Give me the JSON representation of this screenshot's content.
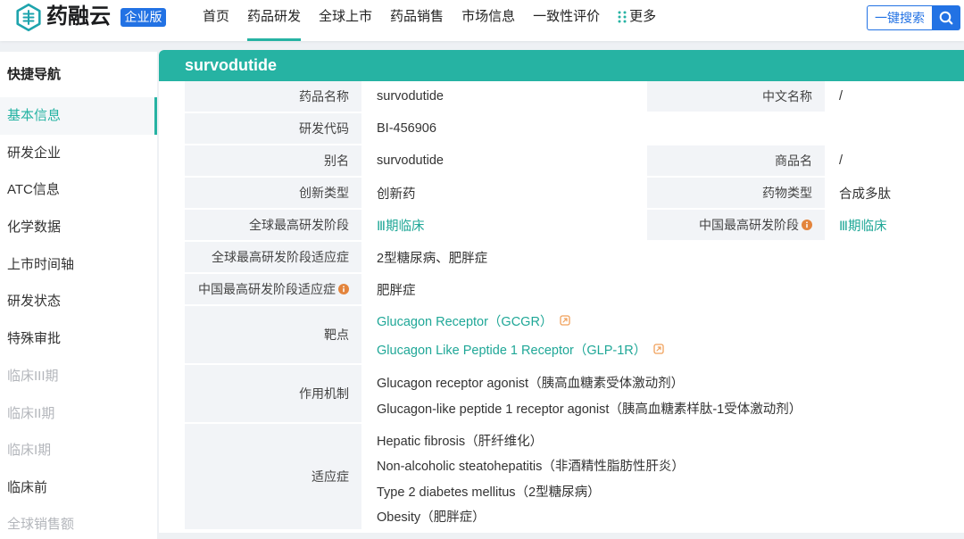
{
  "header": {
    "logo_text": "药融云",
    "edition_badge": "企业版",
    "nav": [
      {
        "label": "首页"
      },
      {
        "label": "药品研发",
        "active": true
      },
      {
        "label": "全球上市"
      },
      {
        "label": "药品销售"
      },
      {
        "label": "市场信息"
      },
      {
        "label": "一致性评价"
      },
      {
        "label": "更多",
        "icon": "grid-dots-icon"
      }
    ],
    "quick_search_label": "一键搜索",
    "search_icon": "search-icon"
  },
  "sidebar": {
    "title": "快捷导航",
    "items": [
      {
        "label": "基本信息",
        "active": true
      },
      {
        "label": "研发企业"
      },
      {
        "label": "ATC信息"
      },
      {
        "label": "化学数据"
      },
      {
        "label": "上市时间轴"
      },
      {
        "label": "研发状态"
      },
      {
        "label": "特殊审批"
      },
      {
        "label": "临床III期",
        "disabled": true
      },
      {
        "label": "临床II期",
        "disabled": true
      },
      {
        "label": "临床I期",
        "disabled": true
      },
      {
        "label": "临床前"
      },
      {
        "label": "全球销售额",
        "disabled": true
      }
    ]
  },
  "drug": {
    "title": "survodutide",
    "fields": {
      "drug_name": {
        "label": "药品名称",
        "value": "survodutide"
      },
      "chinese_name": {
        "label": "中文名称",
        "value": "/"
      },
      "dev_code": {
        "label": "研发代码",
        "value": "BI-456906"
      },
      "alias": {
        "label": "别名",
        "value": "survodutide"
      },
      "trade_name": {
        "label": "商品名",
        "value": "/"
      },
      "innovation_type": {
        "label": "创新类型",
        "value": "创新药"
      },
      "drug_type": {
        "label": "药物类型",
        "value": "合成多肽"
      },
      "global_highest_phase": {
        "label": "全球最高研发阶段",
        "value": "Ⅲ期临床"
      },
      "china_highest_phase": {
        "label": "中国最高研发阶段",
        "value": "Ⅲ期临床"
      },
      "global_phase_indications": {
        "label": "全球最高研发阶段适应症",
        "value": "2型糖尿病、肥胖症"
      },
      "china_phase_indications": {
        "label": "中国最高研发阶段适应症",
        "value": "肥胖症"
      },
      "targets": {
        "label": "靶点",
        "items": [
          "Glucagon Receptor（GCGR）",
          "Glucagon Like Peptide 1 Receptor（GLP-1R）"
        ]
      },
      "mechanism": {
        "label": "作用机制",
        "items": [
          "Glucagon receptor agonist（胰高血糖素受体激动剂）",
          "Glucagon-like peptide 1 receptor agonist（胰高血糖素样肽-1受体激动剂）"
        ]
      },
      "indications": {
        "label": "适应症",
        "items": [
          "Hepatic fibrosis（肝纤维化）",
          "Non-alcoholic steatohepatitis（非酒精性脂肪性肝炎）",
          "Type 2 diabetes mellitus（2型糖尿病）",
          "Obesity（肥胖症）"
        ]
      }
    }
  },
  "icons": {
    "logo": "logo-icon",
    "more": "grid-dots-icon",
    "search": "search-icon",
    "info": "info-icon",
    "external_link": "external-link-icon"
  },
  "colors": {
    "accent_teal": "#26b3a3",
    "link_teal": "#1fa797",
    "logo_teal": "#1ea4ad",
    "brand_blue": "#2272e4",
    "info_orange": "#e3843c",
    "ext_link_orange": "#f0a05a",
    "disabled_text": "#b3b6bb",
    "label_bg": "#f2f4f7",
    "page_bg": "#eef1f4"
  }
}
